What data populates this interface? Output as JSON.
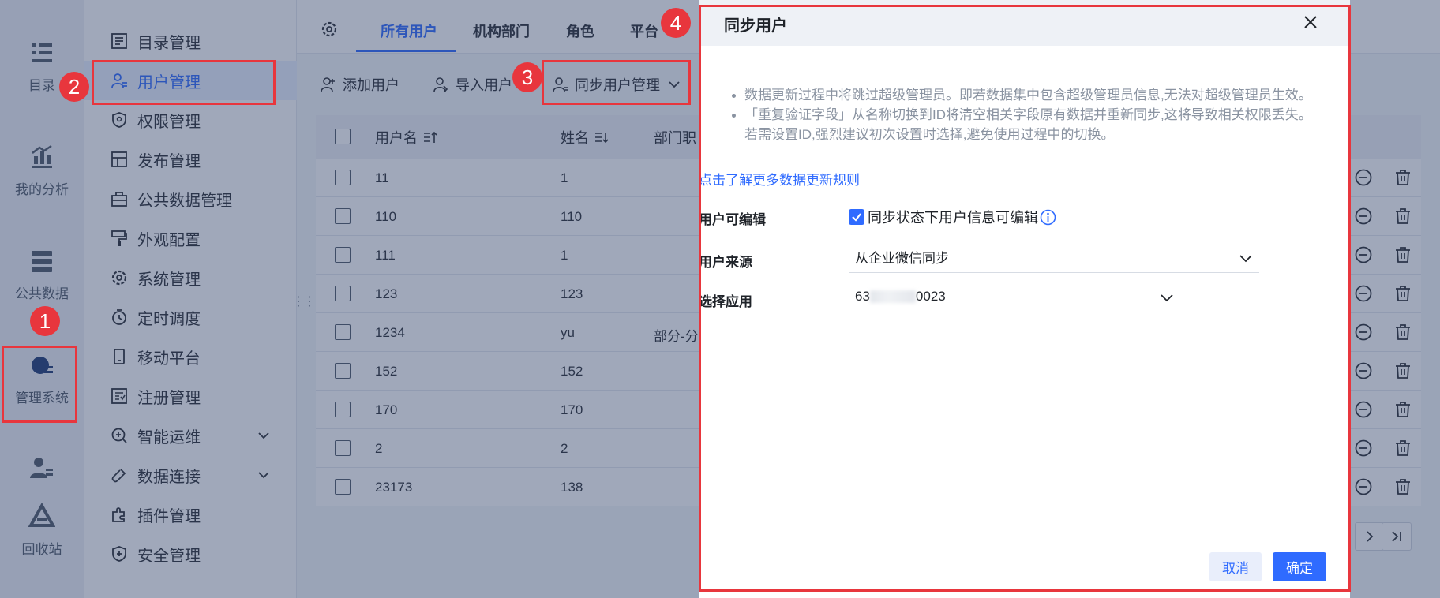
{
  "rail": {
    "items": [
      {
        "label": "目录",
        "icon": "list-icon"
      },
      {
        "label": "我的分析",
        "icon": "analysis-icon"
      },
      {
        "label": "公共数据",
        "icon": "database-icon"
      },
      {
        "label": "管理系统",
        "icon": "gear-icon",
        "active": true
      },
      {
        "label": "",
        "icon": "user-manage-icon"
      },
      {
        "label": "回收站",
        "icon": "recycle-bin-icon"
      }
    ]
  },
  "menu": {
    "items": [
      {
        "label": "目录管理"
      },
      {
        "label": "用户管理",
        "active": true
      },
      {
        "label": "权限管理"
      },
      {
        "label": "发布管理"
      },
      {
        "label": "公共数据管理"
      },
      {
        "label": "外观配置"
      },
      {
        "label": "系统管理"
      },
      {
        "label": "定时调度"
      },
      {
        "label": "移动平台"
      },
      {
        "label": "注册管理"
      },
      {
        "label": "智能运维",
        "expandable": true
      },
      {
        "label": "数据连接",
        "expandable": true
      },
      {
        "label": "插件管理"
      },
      {
        "label": "安全管理"
      }
    ]
  },
  "tabs": {
    "items": [
      "所有用户",
      "机构部门",
      "角色",
      "平台"
    ],
    "active": "所有用户"
  },
  "toolbar": {
    "add_user": "添加用户",
    "import_user": "导入用户",
    "sync_manage": "同步用户管理"
  },
  "table": {
    "headers": {
      "username": "用户名",
      "name": "姓名",
      "dept": "部门职"
    },
    "rows": [
      {
        "username": "11",
        "name": "1",
        "dept": ""
      },
      {
        "username": "110",
        "name": "110",
        "dept": ""
      },
      {
        "username": "111",
        "name": "1",
        "dept": ""
      },
      {
        "username": "123",
        "name": "123",
        "dept": ""
      },
      {
        "username": "1234",
        "name": "yu",
        "dept": "部分-分"
      },
      {
        "username": "152",
        "name": "152",
        "dept": ""
      },
      {
        "username": "170",
        "name": "170",
        "dept": ""
      },
      {
        "username": "2",
        "name": "2",
        "dept": ""
      },
      {
        "username": "23173",
        "name": "138",
        "dept": ""
      }
    ]
  },
  "dialog": {
    "title": "同步用户",
    "notes": [
      "数据更新过程中将跳过超级管理员。即若数据集中包含超级管理员信息,无法对超级管理员生效。",
      "「重复验证字段」从名称切换到ID将清空相关字段原有数据并重新同步,这将导致相关权限丢失。",
      "若需设置ID,强烈建议初次设置时选择,避免使用过程中的切换。"
    ],
    "learn_more": "点击了解更多数据更新规则",
    "editable_label": "用户可编辑",
    "editable_checkbox": "同步状态下用户信息可编辑",
    "editable_checked": true,
    "source_label": "用户来源",
    "source_value": "从企业微信同步",
    "app_label": "选择应用",
    "app_value_prefix": "63",
    "app_value_suffix": "0023",
    "cancel": "取消",
    "confirm": "确定"
  },
  "annotations": {
    "badge1": "1",
    "badge2": "2",
    "badge3": "3",
    "badge4": "4"
  },
  "colors": {
    "accent": "#2f6bff",
    "highlight": "#e8363d"
  }
}
